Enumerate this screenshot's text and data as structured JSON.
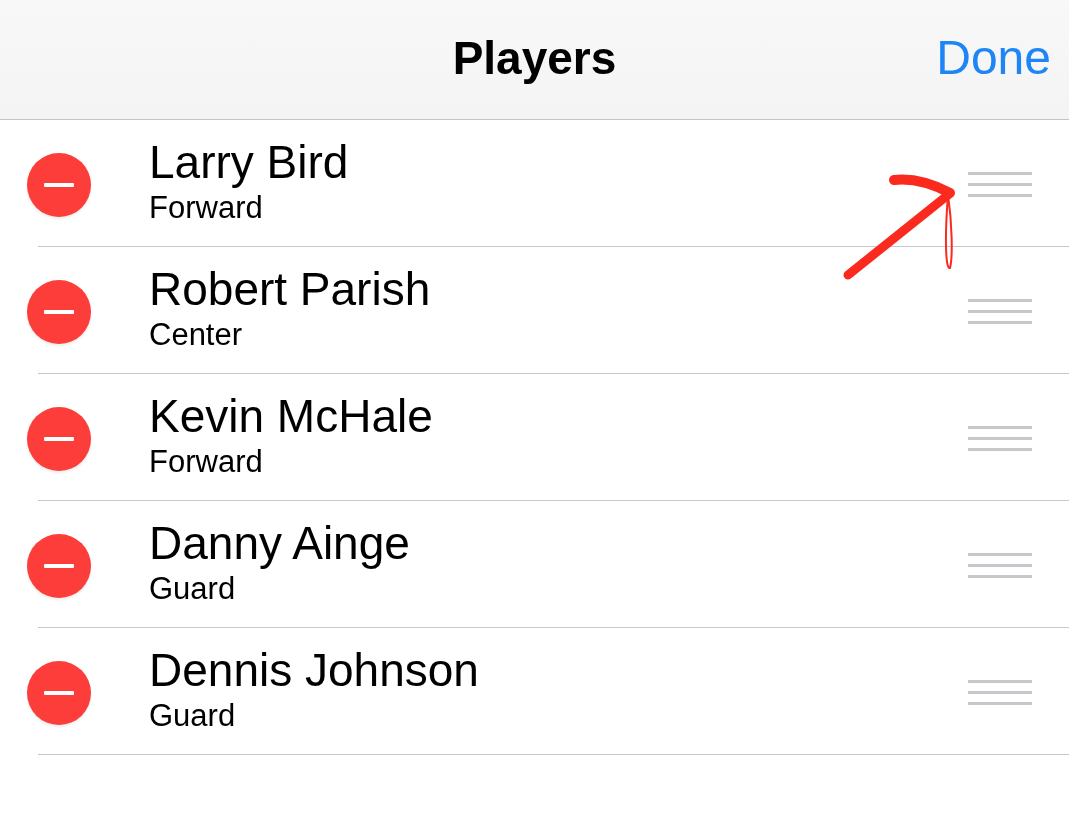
{
  "nav_bar": {
    "title": "Players",
    "done_button": "Done"
  },
  "editing": true,
  "players": [
    {
      "name": "Larry Bird",
      "position": "Forward"
    },
    {
      "name": "Robert Parish",
      "position": "Center"
    },
    {
      "name": "Kevin McHale",
      "position": "Forward"
    },
    {
      "name": "Danny Ainge",
      "position": "Guard"
    },
    {
      "name": "Dennis Johnson",
      "position": "Guard"
    }
  ],
  "annotation": {
    "kind": "arrow"
  }
}
